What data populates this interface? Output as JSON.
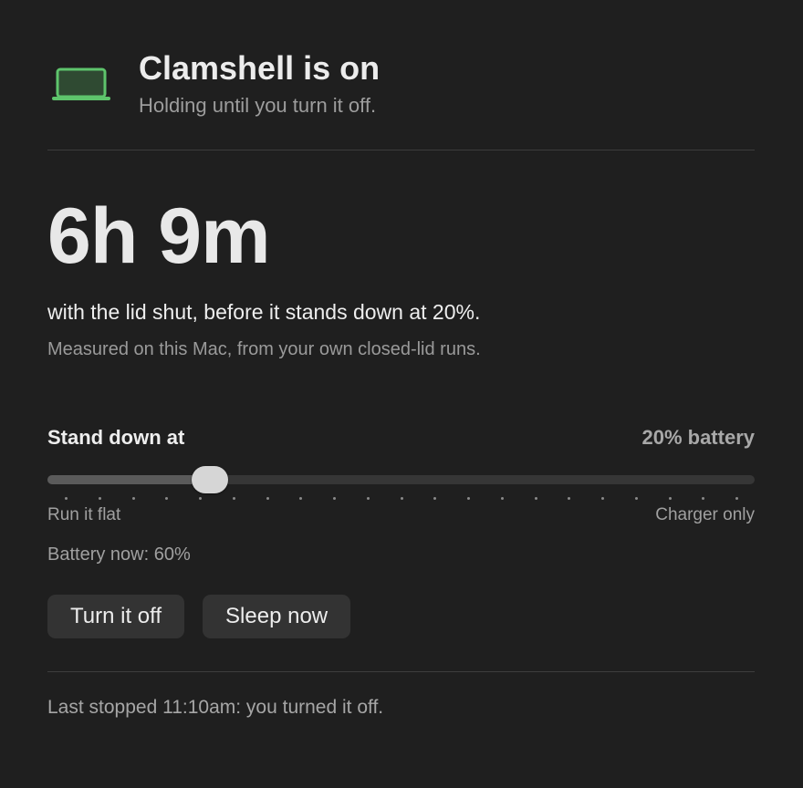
{
  "header": {
    "title": "Clamshell is on",
    "subtitle": "Holding until you turn it off.",
    "icon": "laptop-icon",
    "icon_color": "#5ec46c"
  },
  "estimate": {
    "time": "6h 9m",
    "lead": "with the lid shut, before it stands down at 20%.",
    "note": "Measured on this Mac, from your own closed-lid runs."
  },
  "threshold": {
    "label": "Stand down at",
    "value_text": "20% battery",
    "min_label": "Run it flat",
    "max_label": "Charger only",
    "position_fraction": 0.215,
    "tick_count": 21
  },
  "battery": {
    "now_text": "Battery now: 60%"
  },
  "actions": {
    "turn_off_label": "Turn it off",
    "sleep_label": "Sleep now"
  },
  "footer": {
    "last_stopped": "Last stopped 11:10am: you turned it off."
  }
}
